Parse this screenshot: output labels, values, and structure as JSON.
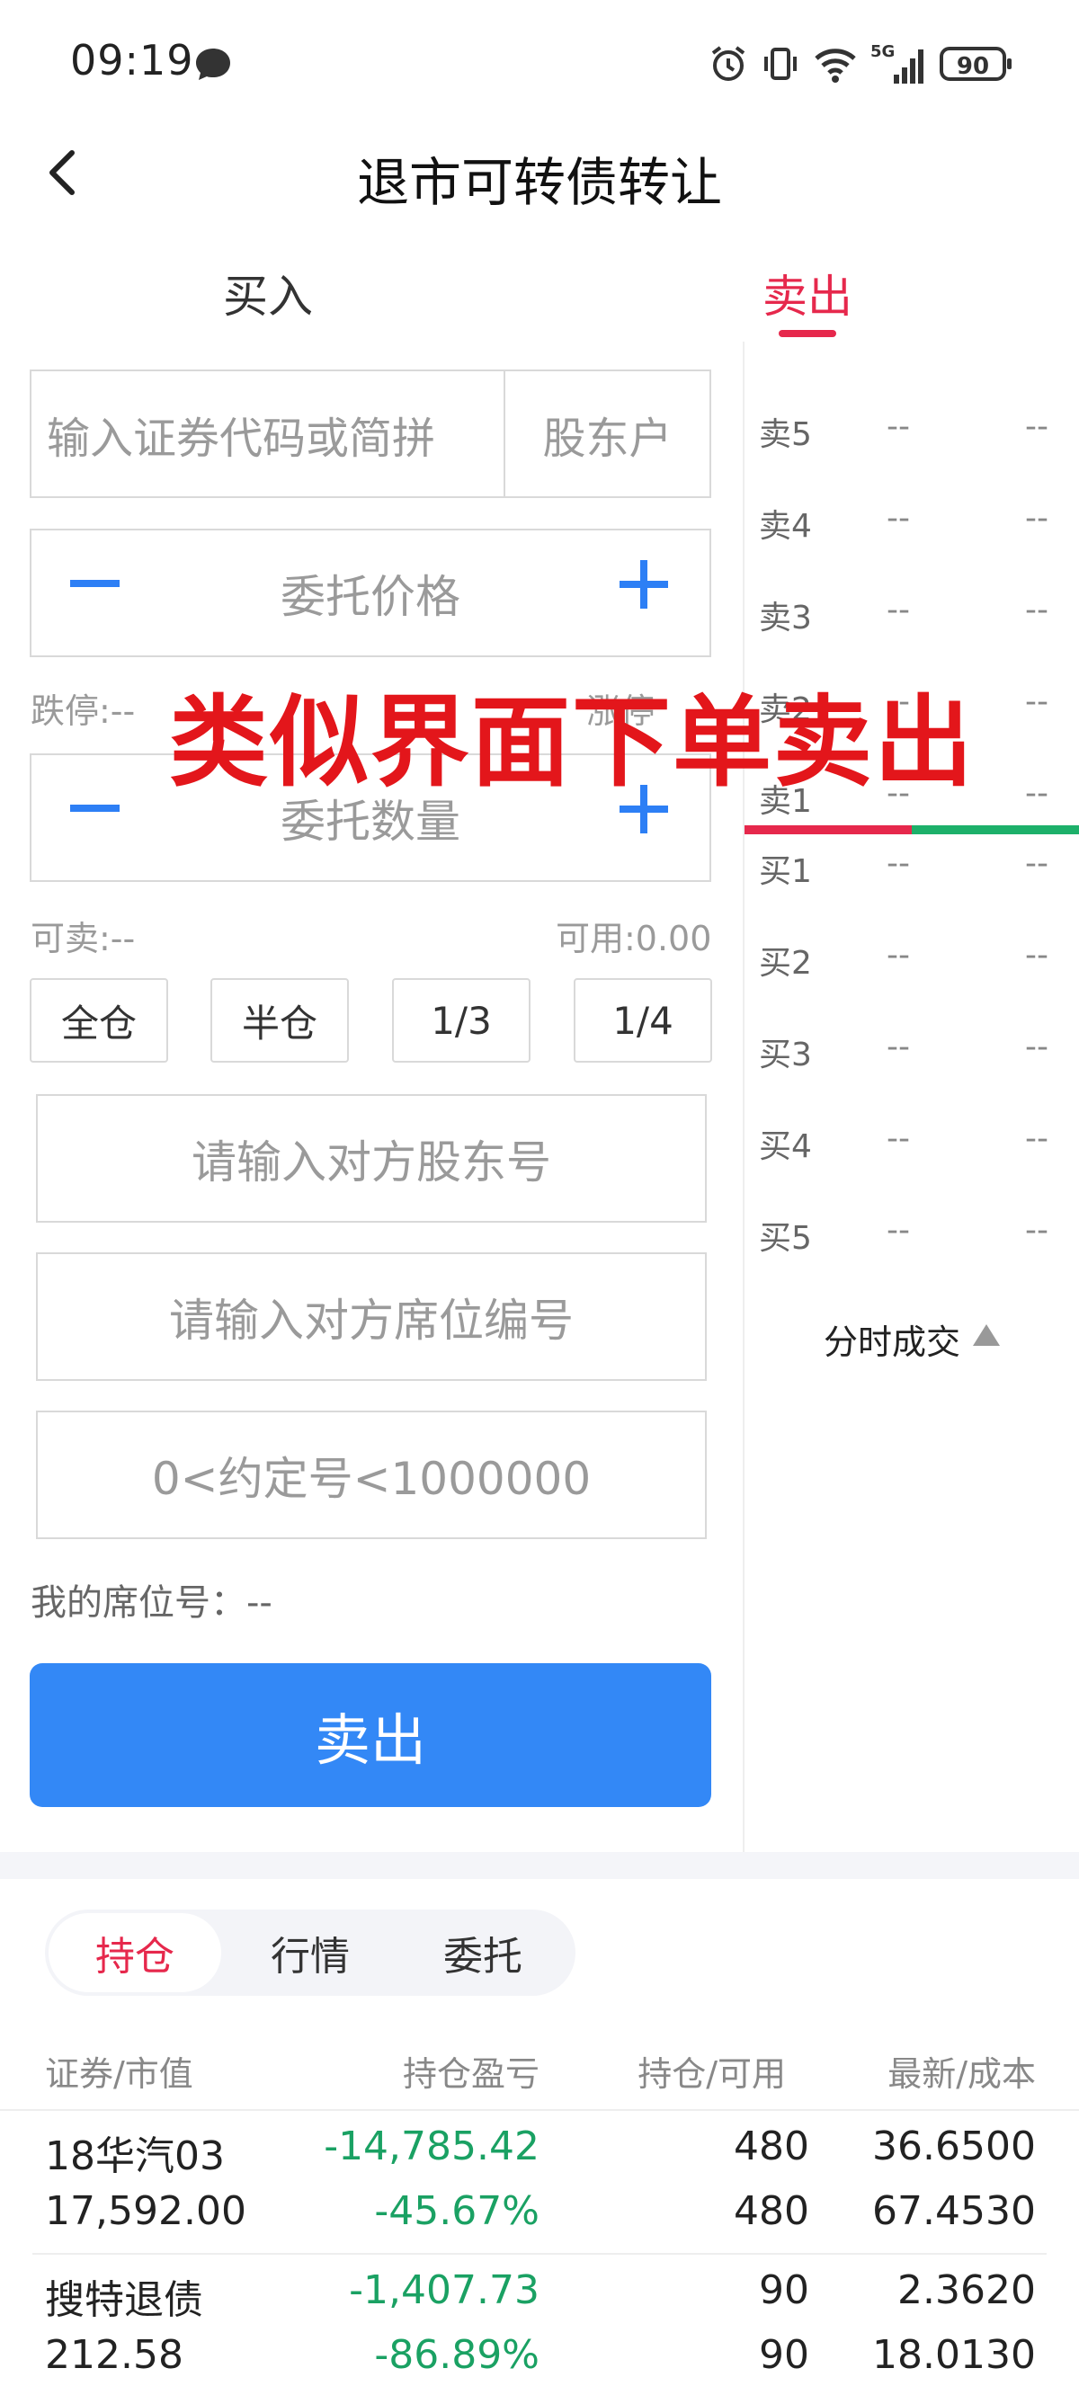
{
  "status_bar": {
    "time": "09:19",
    "battery": "90",
    "network": "5G"
  },
  "header": {
    "title": "退市可转债转让"
  },
  "tabs": {
    "buy": "买入",
    "sell": "卖出"
  },
  "form": {
    "code_placeholder": "输入证券代码或简拼",
    "holder_label": "股东户",
    "price_label": "委托价格",
    "qty_label": "委托数量",
    "limit_down": "跌停:--",
    "limit_up": "涨停",
    "sellable": "可卖:--",
    "available": "可用:0.00",
    "ratios": [
      "全仓",
      "半仓",
      "1/3",
      "1/4"
    ],
    "counterparty_holder_placeholder": "请输入对方股东号",
    "counterparty_seat_placeholder": "请输入对方席位编号",
    "agreement_placeholder": "0<约定号<1000000",
    "my_seat": "我的席位号：--",
    "submit": "卖出"
  },
  "order_book": {
    "sell": [
      {
        "label": "卖5",
        "price": "--",
        "volume": "--"
      },
      {
        "label": "卖4",
        "price": "--",
        "volume": "--"
      },
      {
        "label": "卖3",
        "price": "--",
        "volume": "--"
      },
      {
        "label": "卖2",
        "price": "--",
        "volume": "--"
      },
      {
        "label": "卖1",
        "price": "--",
        "volume": "--"
      }
    ],
    "buy": [
      {
        "label": "买1",
        "price": "--",
        "volume": "--"
      },
      {
        "label": "买2",
        "price": "--",
        "volume": "--"
      },
      {
        "label": "买3",
        "price": "--",
        "volume": "--"
      },
      {
        "label": "买4",
        "price": "--",
        "volume": "--"
      },
      {
        "label": "买5",
        "price": "--",
        "volume": "--"
      }
    ],
    "tick_trade": "分时成交"
  },
  "overlay_text": "类似界面下单卖出",
  "bottom_tabs": {
    "hold": "持仓",
    "quote": "行情",
    "order": "委托"
  },
  "table": {
    "headers": [
      "证券/市值",
      "持仓盈亏",
      "持仓/可用",
      "最新/成本"
    ],
    "rows": [
      {
        "name": "18华汽03",
        "market_value": "17,592.00",
        "pnl": "-14,785.42",
        "pnl_pct": "-45.67%",
        "hold": "480",
        "avail": "480",
        "last": "36.6500",
        "cost": "67.4530"
      },
      {
        "name": "搜特退债",
        "market_value": "212.58",
        "pnl": "-1,407.73",
        "pnl_pct": "-86.89%",
        "hold": "90",
        "avail": "90",
        "last": "2.3620",
        "cost": "18.0130"
      }
    ]
  },
  "colors": {
    "accent_red": "#e6284c",
    "primary_blue": "#3388f6",
    "loss_green": "#1aa163",
    "overlay_red": "#e3161b"
  }
}
